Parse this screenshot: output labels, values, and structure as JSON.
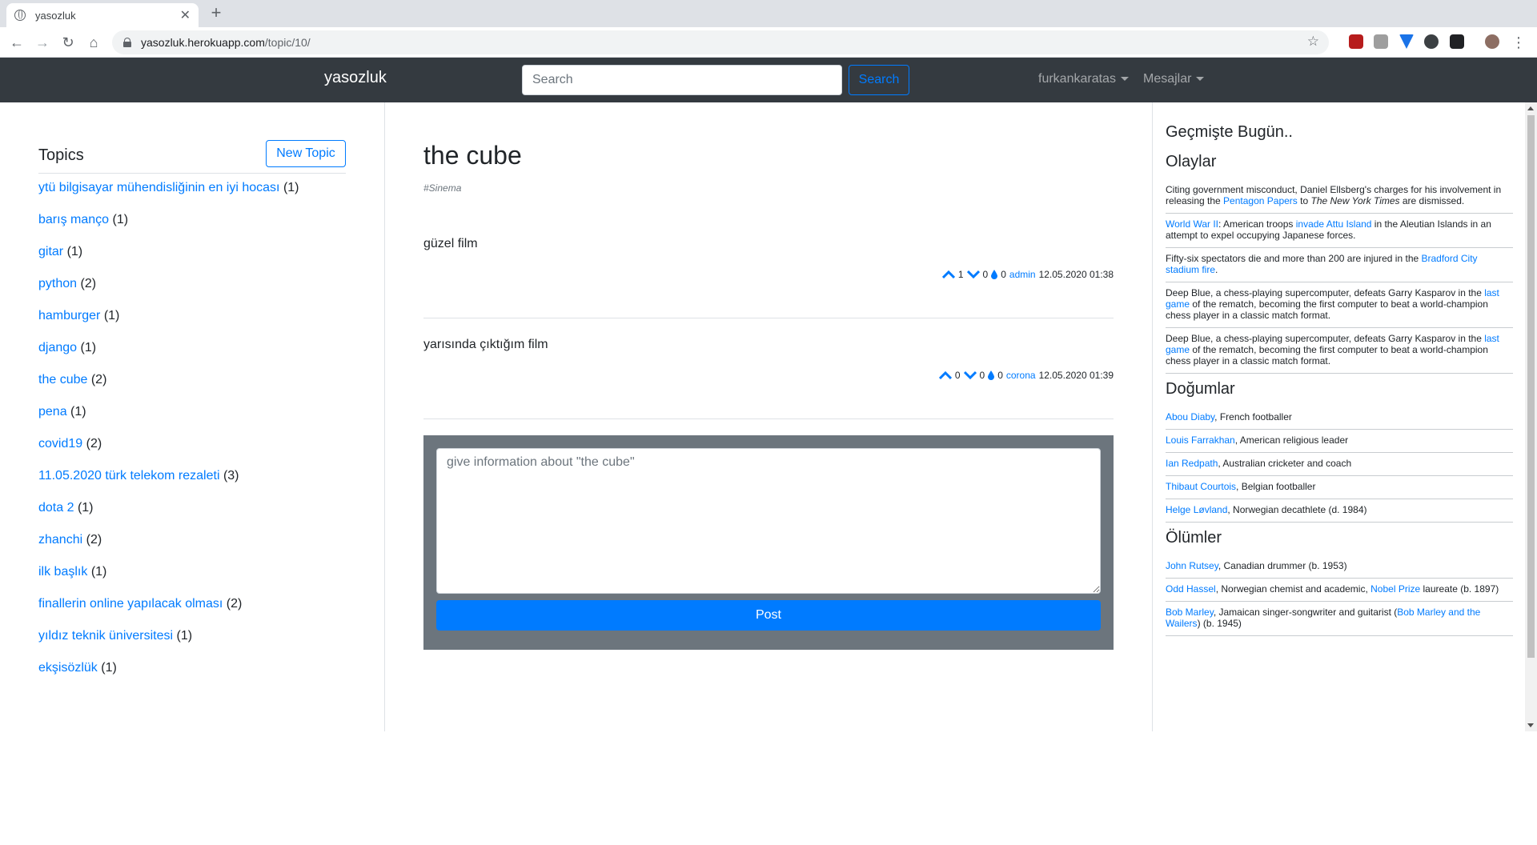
{
  "browser": {
    "tab_title": "yasozluk",
    "url_host": "yasozluk.herokuapp.com",
    "url_path": "/topic/10/"
  },
  "navbar": {
    "brand": "yasozluk",
    "search_placeholder": "Search",
    "search_button": "Search",
    "user_menu": "furkankaratas",
    "messages_menu": "Mesajlar"
  },
  "sidebar": {
    "title": "Topics",
    "new_topic_button": "New Topic",
    "topics": [
      {
        "title": "ytü bilgisayar mühendisliğinin en iyi hocası",
        "count": "(1)"
      },
      {
        "title": "barış manço",
        "count": "(1)"
      },
      {
        "title": "gitar",
        "count": "(1)"
      },
      {
        "title": "python",
        "count": "(2)"
      },
      {
        "title": "hamburger",
        "count": "(1)"
      },
      {
        "title": "django",
        "count": "(1)"
      },
      {
        "title": "the cube",
        "count": "(2)"
      },
      {
        "title": "pena",
        "count": "(1)"
      },
      {
        "title": "covid19",
        "count": "(2)"
      },
      {
        "title": "11.05.2020 türk telekom rezaleti",
        "count": "(3)"
      },
      {
        "title": "dota 2",
        "count": "(1)"
      },
      {
        "title": "zhanchi",
        "count": "(2)"
      },
      {
        "title": "ilk başlık",
        "count": "(1)"
      },
      {
        "title": "finallerin online yapılacak olması",
        "count": "(2)"
      },
      {
        "title": "yıldız teknik üniversitesi",
        "count": "(1)"
      },
      {
        "title": "ekşisözlük",
        "count": "(1)"
      }
    ]
  },
  "topic": {
    "title": "the cube",
    "tag": "#Sinema",
    "entries": [
      {
        "text": "güzel film",
        "upvotes": "1",
        "downvotes": "0",
        "drops": "0",
        "author": "admin",
        "date": "12.05.2020 01:38"
      },
      {
        "text": "yarısında çıktığım film",
        "upvotes": "0",
        "downvotes": "0",
        "drops": "0",
        "author": "corona",
        "date": "12.05.2020 01:39"
      }
    ],
    "post_placeholder": "give information about \"the cube\"",
    "post_button": "Post"
  },
  "history": {
    "title": "Geçmişte Bugün..",
    "events_title": "Olaylar",
    "events": [
      {
        "t1": "Citing government misconduct, Daniel Ellsberg's charges for his involvement in releasing the ",
        "l1": "Pentagon Papers",
        "t2": " to ",
        "i1": "The New York Times",
        "t3": " are dismissed."
      },
      {
        "l1": "World War II",
        "t1": ": American troops ",
        "l2": "invade Attu Island",
        "t2": " in the Aleutian Islands in an attempt to expel occupying Japanese forces."
      },
      {
        "t1": "Fifty-six spectators die and more than 200 are injured in the ",
        "l1": "Bradford City stadium fire",
        "t2": "."
      },
      {
        "t1": "Deep Blue, a chess-playing supercomputer, defeats Garry Kasparov in the ",
        "l1": "last game",
        "t2": " of the rematch, becoming the first computer to beat a world-champion chess player in a classic match format."
      },
      {
        "t1": "Deep Blue, a chess-playing supercomputer, defeats Garry Kasparov in the ",
        "l1": "last game",
        "t2": " of the rematch, becoming the first computer to beat a world-champion chess player in a classic match format."
      }
    ],
    "births_title": "Doğumlar",
    "births": [
      {
        "name": "Abou Diaby",
        "desc": ", French footballer"
      },
      {
        "name": "Louis Farrakhan",
        "desc": ", American religious leader"
      },
      {
        "name": "Ian Redpath",
        "desc": ", Australian cricketer and coach"
      },
      {
        "name": "Thibaut Courtois",
        "desc": ", Belgian footballer"
      },
      {
        "name": "Helge Løvland",
        "desc": ", Norwegian decathlete (d. 1984)"
      }
    ],
    "deaths_title": "Ölümler",
    "deaths": [
      {
        "name": "John Rutsey",
        "t1": ", Canadian drummer (b. 1953)"
      },
      {
        "name": "Odd Hassel",
        "t1": ", Norwegian chemist and academic, ",
        "l2": "Nobel Prize",
        "t2": " laureate (b. 1897)"
      },
      {
        "name": "Bob Marley",
        "t1": ", Jamaican singer-songwriter and guitarist (",
        "l2": "Bob Marley and the Wailers",
        "t2": ") (b. 1945)"
      }
    ]
  },
  "colors": {
    "navbar_bg": "#343a40",
    "link": "#007bff",
    "post_panel": "#6c757d"
  }
}
